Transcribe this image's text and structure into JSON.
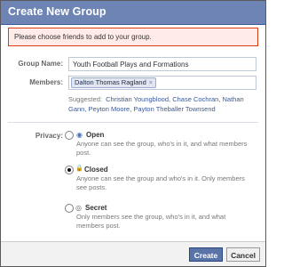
{
  "dialog": {
    "title": "Create New Group",
    "alert_text": "Please choose friends to add to your group."
  },
  "form": {
    "group_name_label": "Group Name:",
    "group_name_value": "Youth Football Plays and Formations",
    "members_label": "Members:",
    "member_tokens": [
      {
        "name": "Dalton Thomas Ragland",
        "remove_glyph": "×"
      }
    ],
    "suggested_label": "Suggested:",
    "suggested_names": [
      "Christian Youngblood,",
      "Chase Cochran,",
      "Nathan Gann,",
      "Peyton Moore,",
      "Payton Theballer Townsend"
    ]
  },
  "privacy": {
    "label": "Privacy:",
    "selected": "closed",
    "options": [
      {
        "id": "open",
        "title": "Open",
        "icon": "globe-icon",
        "icon_glyph": "◉",
        "description": "Anyone can see the group, who's in it, and what members post."
      },
      {
        "id": "closed",
        "title": "Closed",
        "icon": "lock-icon",
        "icon_glyph": "🔒",
        "description": "Anyone can see the group and who's in it. Only members see posts."
      },
      {
        "id": "secret",
        "title": "Secret",
        "icon": "secret-icon",
        "icon_glyph": "◎",
        "description": "Only members see the group, who's in it, and what members post."
      }
    ]
  },
  "footer": {
    "create_label": "Create",
    "cancel_label": "Cancel"
  },
  "colors": {
    "titlebar": "#6d84b4",
    "link": "#3b5998",
    "alert_bg": "#ffebe8",
    "alert_border": "#dd3c10"
  }
}
